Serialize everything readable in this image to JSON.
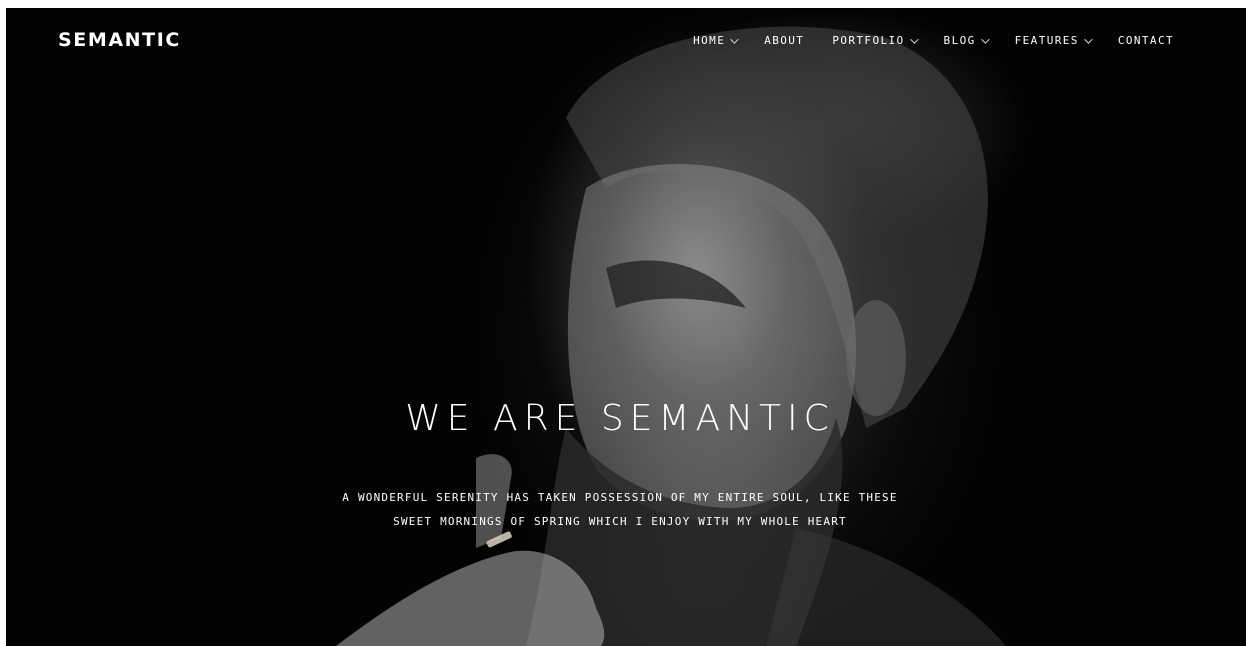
{
  "brand": {
    "name": "SEMANTIC"
  },
  "nav": {
    "items": [
      {
        "label": "HOME",
        "has_dropdown": true
      },
      {
        "label": "ABOUT",
        "has_dropdown": false
      },
      {
        "label": "PORTFOLIO",
        "has_dropdown": true
      },
      {
        "label": "BLOG",
        "has_dropdown": true
      },
      {
        "label": "FEATURES",
        "has_dropdown": true
      },
      {
        "label": "CONTACT",
        "has_dropdown": false
      }
    ]
  },
  "hero": {
    "title": "WE ARE SEMANTIC",
    "subtitle_line1": "A WONDERFUL SERENITY HAS TAKEN POSSESSION OF MY ENTIRE SOUL, LIKE THESE",
    "subtitle_line2": "SWEET MORNINGS OF SPRING WHICH I ENJOY WITH MY WHOLE HEART"
  },
  "colors": {
    "background": "#000000",
    "text": "#ffffff"
  }
}
